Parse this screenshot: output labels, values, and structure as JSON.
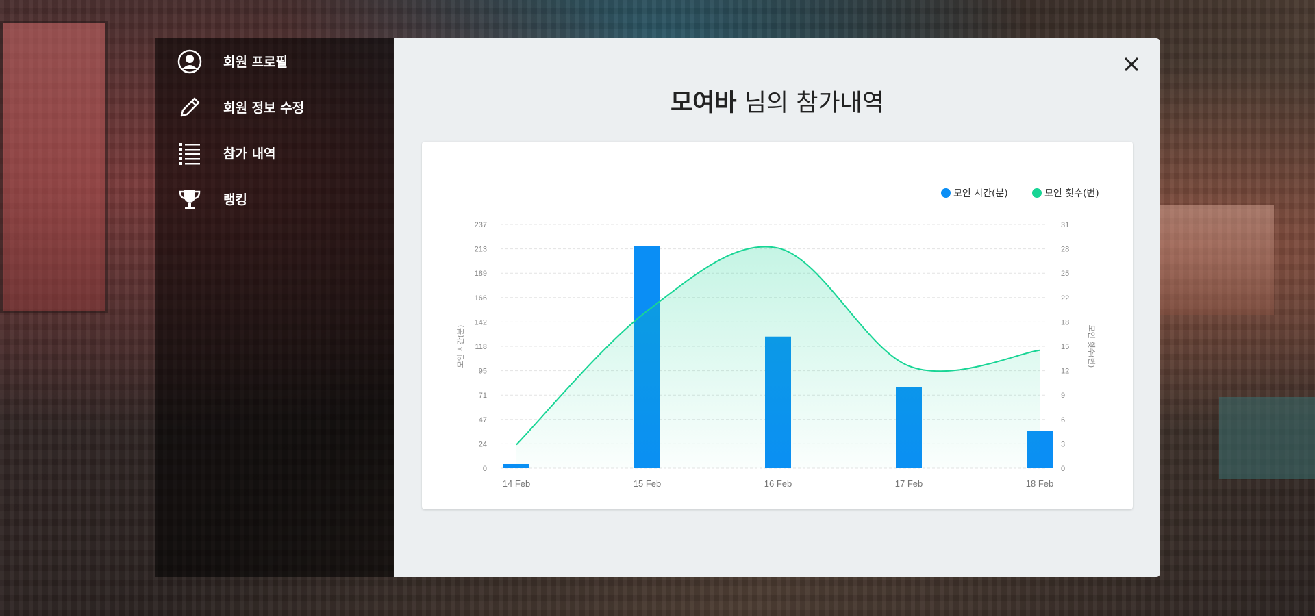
{
  "sidebar": {
    "items": [
      {
        "label": "회원 프로필",
        "icon": "user-circle-icon"
      },
      {
        "label": "회원 정보 수정",
        "icon": "pencil-icon"
      },
      {
        "label": "참가 내역",
        "icon": "list-icon"
      },
      {
        "label": "랭킹",
        "icon": "trophy-icon"
      }
    ]
  },
  "modal": {
    "title_name": "모여바",
    "title_suffix": " 님의 참가내역",
    "close_icon": "close-icon"
  },
  "colors": {
    "bar": "#0a8ef5",
    "line": "#18d595",
    "fill": "#d9f8ea"
  },
  "chart_data": {
    "type": "bar",
    "categories": [
      "14 Feb",
      "15 Feb",
      "16 Feb",
      "17 Feb",
      "18 Feb"
    ],
    "series": [
      {
        "name": "모인 시간(분)",
        "type": "bar",
        "axis": "left",
        "values": [
          4,
          216,
          128,
          79,
          36
        ]
      },
      {
        "name": "모인 횟수(번)",
        "type": "line",
        "axis": "right",
        "values": [
          3,
          20,
          28,
          13,
          15
        ]
      }
    ],
    "y_left": {
      "label": "모인 시간(분)",
      "ticks": [
        0,
        24,
        47,
        71,
        95,
        118,
        142,
        166,
        189,
        213,
        237
      ],
      "ylim": [
        0,
        237
      ]
    },
    "y_right": {
      "label": "모인 횟수(번)",
      "ticks": [
        0,
        3,
        6,
        9,
        12,
        15,
        18,
        22,
        25,
        28,
        31
      ],
      "ylim": [
        0,
        31
      ]
    },
    "legend_position": "top-right",
    "grid": true
  }
}
